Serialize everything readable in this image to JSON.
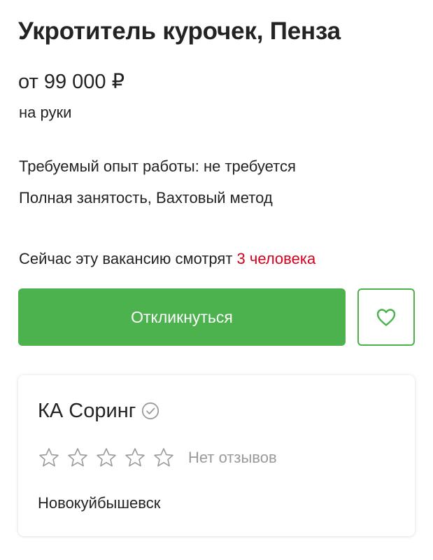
{
  "vacancy": {
    "title": "Укротитель курочек, Пенза",
    "salary": "от 99 000 ₽",
    "salary_note": "на руки",
    "experience": "Требуемый опыт работы: не требуется",
    "employment": "Полная занятость, Вахтовый метод",
    "viewers_prefix": "Сейчас эту вакансию смотрят",
    "viewers_count": "3 человека"
  },
  "actions": {
    "respond_label": "Откликнуться",
    "favorite_icon": "heart-icon"
  },
  "company": {
    "name": "КА Соринг",
    "verified_icon": "check-circle-icon",
    "rating_stars_total": 5,
    "rating_filled": 0,
    "reviews_text": "Нет отзывов",
    "city": "Новокуйбышевск"
  },
  "colors": {
    "accent_green": "#4bb24e",
    "viewers_red": "#d6001c",
    "text": "#232323",
    "muted": "#9a9a9a"
  }
}
